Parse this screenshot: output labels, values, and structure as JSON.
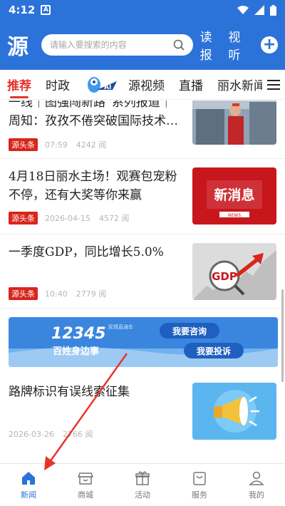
{
  "status_bar": {
    "time": "4:12",
    "notif_letter": "A"
  },
  "header": {
    "logo": "源",
    "search_placeholder": "请输入要搜索的内容",
    "links": [
      "读报",
      "视听"
    ]
  },
  "tabs": [
    {
      "label": "推荐",
      "active": true
    },
    {
      "label": "时政",
      "active": false
    },
    {
      "label": "源视频",
      "active": false
    },
    {
      "label": "直播",
      "active": false
    },
    {
      "label": "丽水新闻联",
      "active": false
    }
  ],
  "feed": {
    "items": [
      {
        "title_line1": "一线｜图强闯新路”系列报道｜",
        "title_line2": "周知：孜孜不倦突破国际技术…",
        "badge": "源头条",
        "date": "07:59",
        "views": "4242 阅"
      },
      {
        "title_line1": "4月18日丽水主场！观赛包宠粉",
        "title_line2": "不停，还有大奖等你来赢",
        "badge": "源头条",
        "date": "2026-04-15",
        "views": "4572 阅",
        "thumb_text": "新消息",
        "thumb_sub": "NEWS"
      },
      {
        "title_line1": "一季度GDP，同比增长5.0%",
        "title_line2": "",
        "badge": "源头条",
        "date": "10:40",
        "views": "2779 阅",
        "thumb_text": "GDP"
      },
      {
        "title_line1": "路牌标识有误线索征集",
        "title_line2": "",
        "date": "2026-03-26",
        "views": "2766 阅"
      }
    ],
    "banner": {
      "number": "12345",
      "slogan": "百姓身边事",
      "tag": "民情直通车",
      "btn1": "我要咨询",
      "btn2": "我要投诉"
    }
  },
  "bottom_nav": [
    {
      "label": "新闻",
      "icon": "home-icon",
      "active": true
    },
    {
      "label": "商城",
      "icon": "shop-icon",
      "active": false
    },
    {
      "label": "活动",
      "icon": "gift-icon",
      "active": false
    },
    {
      "label": "服务",
      "icon": "bag-icon",
      "active": false
    },
    {
      "label": "我的",
      "icon": "user-icon",
      "active": false
    }
  ],
  "colors": {
    "brand": "#2b73d9",
    "accent": "#e3342f",
    "badge": "#d9251c",
    "arrow": "#e8332a"
  }
}
